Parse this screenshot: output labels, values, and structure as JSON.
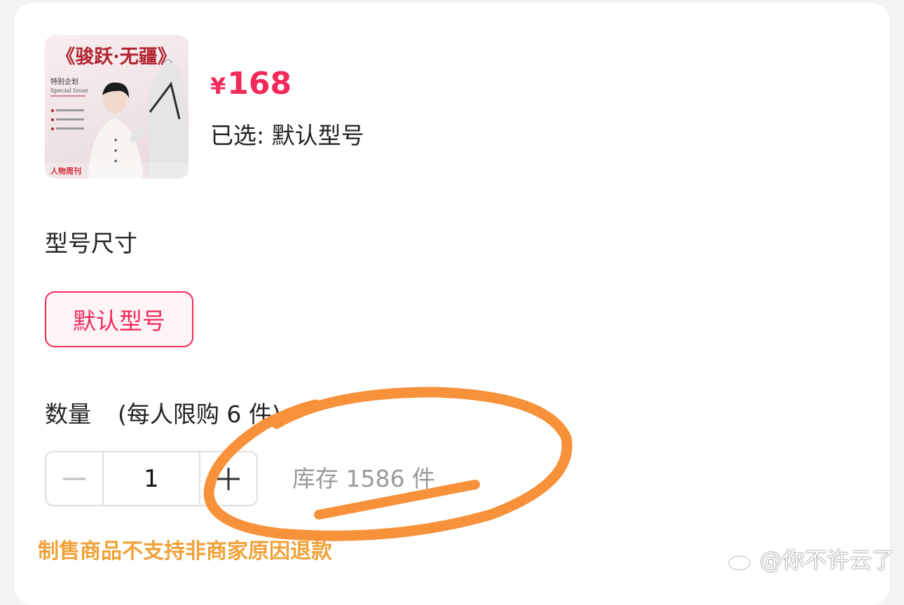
{
  "product": {
    "image_title": "《骏跃·无疆》",
    "image_subtitle_cn": "特别企划",
    "image_subtitle_en": "Special Issue",
    "image_brand": "人物周刊",
    "currency": "¥",
    "price": "168",
    "selected_text": "已选: 默认型号"
  },
  "variant": {
    "section_title": "型号尺寸",
    "options": [
      "默认型号"
    ],
    "selected_index": 0
  },
  "quantity": {
    "label": "数量",
    "limit_text": "(每人限购 6 件)",
    "value": "1",
    "stock_text": "库存 1586 件"
  },
  "notice": "制售商品不支持非商家原因退款",
  "watermark": "@你不许云了",
  "colors": {
    "accent": "#f2295b",
    "notice": "#f0a23a",
    "annotation": "#f7923a"
  },
  "icons": {
    "decrement": "minus-icon",
    "increment": "plus-icon",
    "watermark": "weibo-icon"
  }
}
